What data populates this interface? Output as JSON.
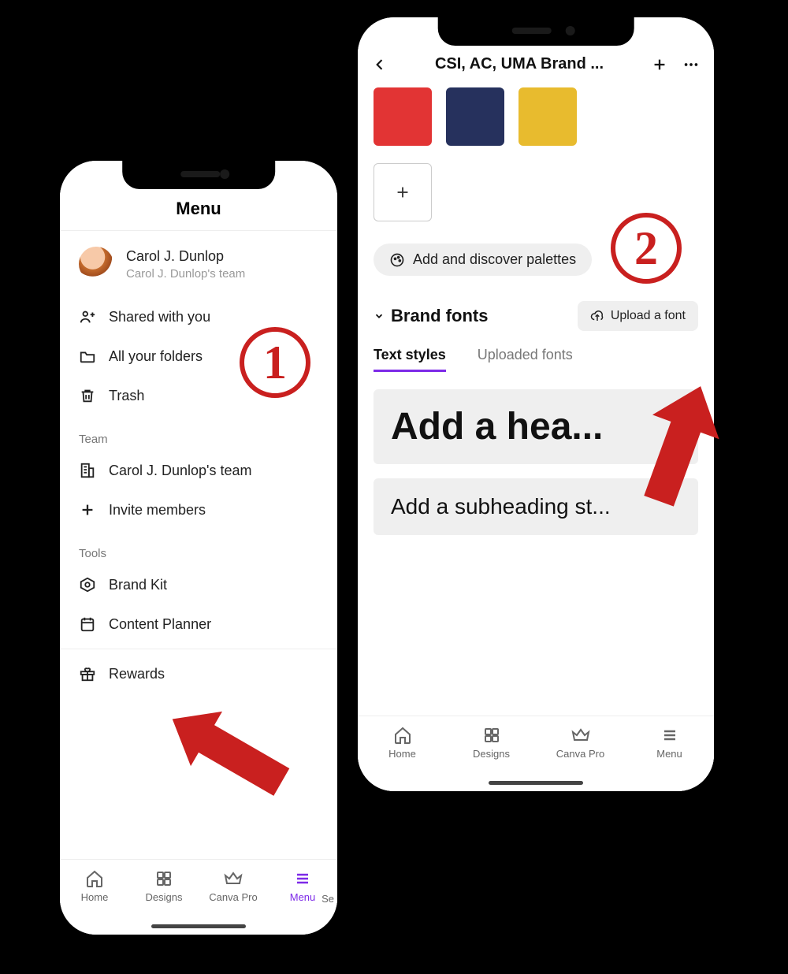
{
  "badge1": "1",
  "badge2": "2",
  "phone1": {
    "menu_title": "Menu",
    "profile": {
      "name": "Carol J. Dunlop",
      "team": "Carol J. Dunlop's team"
    },
    "items": {
      "shared": "Shared with you",
      "folders": "All your folders",
      "trash": "Trash"
    },
    "section_team": "Team",
    "team_items": {
      "team_name": "Carol J. Dunlop's team",
      "invite": "Invite members"
    },
    "section_tools": "Tools",
    "tools": {
      "brand_kit": "Brand Kit",
      "content_planner": "Content Planner",
      "rewards": "Rewards"
    },
    "nav": {
      "home": "Home",
      "designs": "Designs",
      "canva_pro": "Canva Pro",
      "menu": "Menu"
    },
    "nav_overflow": "Se"
  },
  "phone2": {
    "title": "CSI, AC, UMA Brand ...",
    "swatches": [
      "#e23434",
      "#26315d",
      "#e8bb2e"
    ],
    "add_discover": "Add and discover palettes",
    "brand_fonts": "Brand fonts",
    "upload_font": "Upload a font",
    "tabs": {
      "text_styles": "Text styles",
      "uploaded_fonts": "Uploaded fonts"
    },
    "heading_style": "Add a hea...",
    "subheading_style": "Add a subheading st...",
    "nav": {
      "home": "Home",
      "designs": "Designs",
      "canva_pro": "Canva Pro",
      "menu": "Menu"
    }
  }
}
